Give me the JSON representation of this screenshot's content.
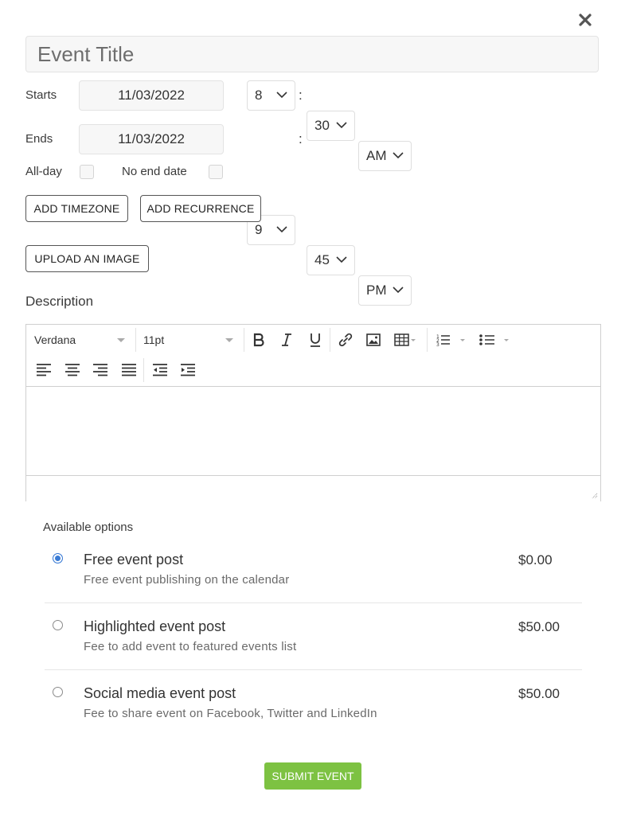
{
  "form": {
    "close_icon": "close-icon",
    "title_placeholder": "Event Title",
    "starts": {
      "label": "Starts",
      "date": "11/03/2022",
      "hour": "8",
      "minute": "30",
      "ampm": "AM"
    },
    "ends": {
      "label": "Ends",
      "date": "11/03/2022",
      "hour": "9",
      "minute": "45",
      "ampm": "PM"
    },
    "time_separator": ":",
    "allday_label": "All-day",
    "noend_label": "No end date",
    "add_timezone": "ADD TIMEZONE",
    "add_recurrence": "ADD RECURRENCE",
    "upload_image": "UPLOAD AN IMAGE"
  },
  "description": {
    "title": "Description",
    "font_family": "Verdana",
    "font_size": "11pt",
    "icons": [
      "bold-icon",
      "italic-icon",
      "underline-icon",
      "link-icon",
      "image-icon",
      "table-icon",
      "numbered-list-icon",
      "bullet-list-icon",
      "align-left-icon",
      "align-center-icon",
      "align-right-icon",
      "align-justify-icon",
      "outdent-icon",
      "indent-icon"
    ]
  },
  "options": {
    "title": "Available options",
    "items": [
      {
        "title": "Free event post",
        "desc": "Free event publishing on the calendar",
        "price": "$0.00",
        "selected": true
      },
      {
        "title": "Highlighted event post",
        "desc": "Fee to add event to featured events list",
        "price": "$50.00",
        "selected": false
      },
      {
        "title": "Social media event post",
        "desc": "Fee to share event on Facebook, Twitter and LinkedIn",
        "price": "$50.00",
        "selected": false
      }
    ]
  },
  "submit_label": "SUBMIT EVENT",
  "colors": {
    "accent_green": "#7dc242",
    "radio_blue": "#3a7bd5"
  }
}
